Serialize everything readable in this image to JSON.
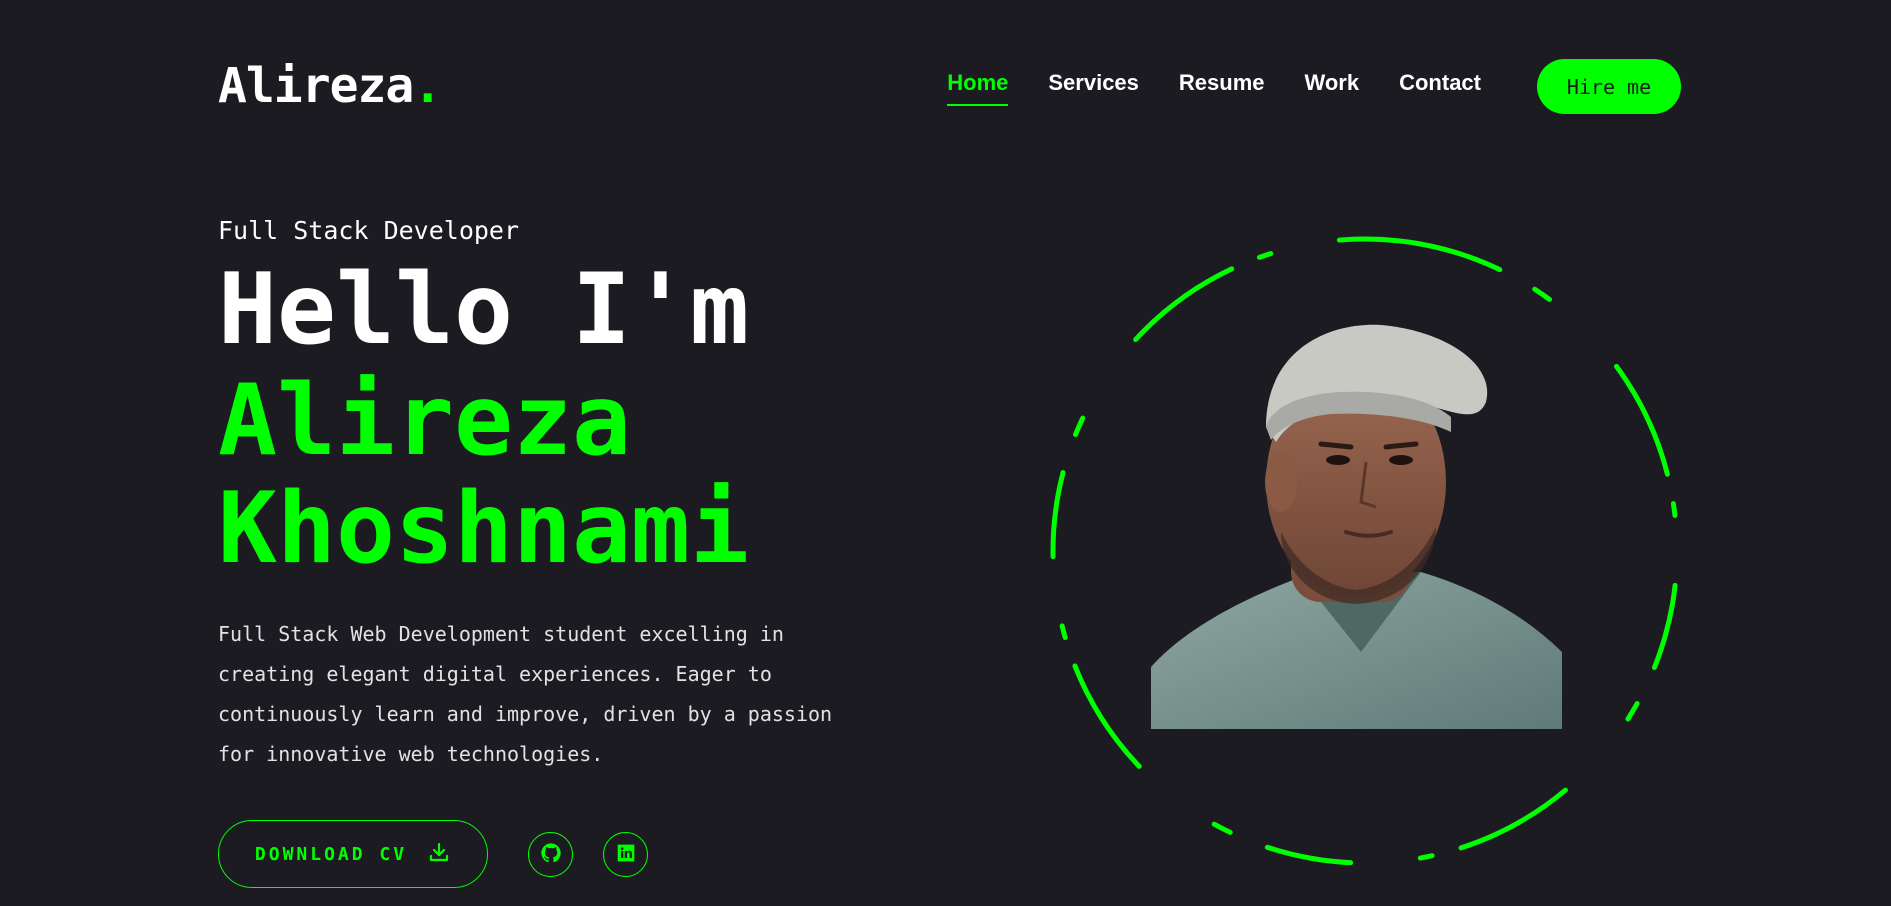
{
  "brand": {
    "name": "Alireza",
    "dot": "."
  },
  "nav": {
    "items": [
      {
        "label": "Home",
        "active": true
      },
      {
        "label": "Services",
        "active": false
      },
      {
        "label": "Resume",
        "active": false
      },
      {
        "label": "Work",
        "active": false
      },
      {
        "label": "Contact",
        "active": false
      }
    ],
    "cta": "Hire me"
  },
  "hero": {
    "role": "Full Stack Developer",
    "greeting": "Hello I'm",
    "first_name": "Alireza",
    "last_name": "Khoshnami",
    "bio_lines": [
      "Full Stack Web Development student excelling in",
      "creating elegant digital experiences. Eager to",
      "continuously learn and improve, driven by a passion",
      "for innovative web technologies."
    ],
    "download_label": "DOWNLOAD CV",
    "icons": {
      "download": "download-icon",
      "github": "github-icon",
      "linkedin": "linkedin-icon"
    }
  },
  "colors": {
    "accent": "#00ff00",
    "background": "#1c1b22",
    "text": "#ffffff"
  }
}
